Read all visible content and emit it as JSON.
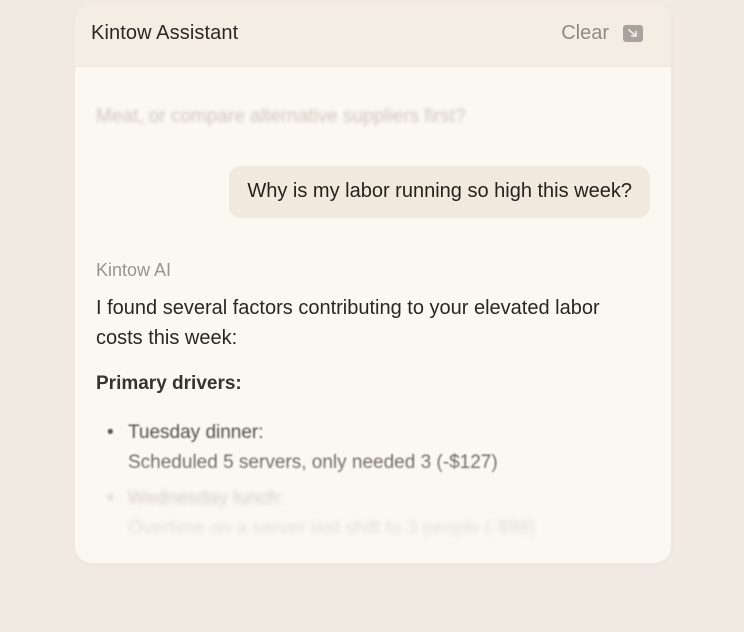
{
  "header": {
    "title": "Kintow Assistant",
    "clear_label": "Clear",
    "collapse_icon": "collapse-arrow-icon"
  },
  "chat": {
    "previous_message_tail": "Meat, or compare alternative suppliers first?",
    "user_message": "Why is my labor running so high this week?",
    "assistant": {
      "name": "Kintow AI",
      "intro": "I found several factors contributing to your elevated labor costs this week:",
      "subheading": "Primary drivers:",
      "drivers": [
        {
          "name": "Tuesday dinner:",
          "detail": "Scheduled 5 servers, only needed 3 (-$127)"
        },
        {
          "name": "Wednesday lunch:",
          "detail": "Overtime on a server last shift to 3 people (-$98)"
        }
      ]
    }
  },
  "colors": {
    "page_background": "#f2ebe3",
    "panel_background": "#fbf8f1",
    "header_background": "#f3ede4",
    "user_bubble": "#f1e9de",
    "muted_text": "#9a948d"
  }
}
